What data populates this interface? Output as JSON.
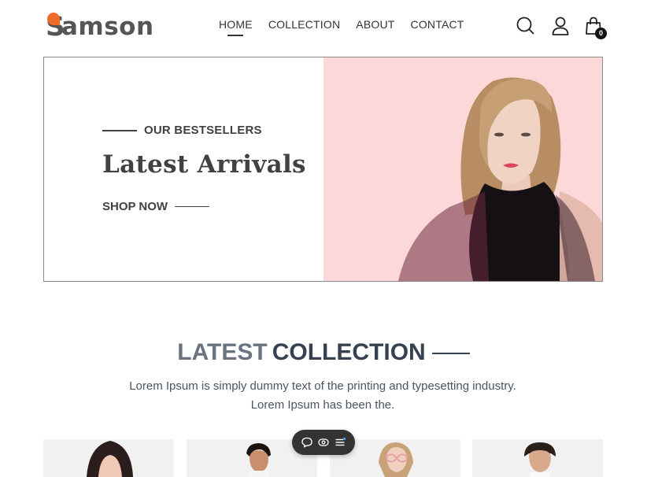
{
  "brand": {
    "logo_letter": "S",
    "logo_rest": "amson",
    "accent_color": "#f06a2a"
  },
  "nav": {
    "items": [
      {
        "label": "HOME",
        "active": true
      },
      {
        "label": "COLLECTION",
        "active": false
      },
      {
        "label": "ABOUT",
        "active": false
      },
      {
        "label": "CONTACT",
        "active": false
      }
    ]
  },
  "header_icons": [
    "search-icon",
    "user-icon",
    "cart-icon"
  ],
  "cart": {
    "count": "0"
  },
  "hero": {
    "eyebrow": "OUR BESTSELLERS",
    "title": "Latest Arrivals",
    "cta": "SHOP NOW",
    "bg_color": "#fcd9d8"
  },
  "collection": {
    "title_light": "LATEST",
    "title_bold": "COLLECTION",
    "description_line1": "Lorem Ipsum is simply dummy text of the printing and typesetting industry.",
    "description_line2": "Lorem Ipsum has been the."
  },
  "products": [
    {
      "image": "product-woman-image"
    },
    {
      "image": "product-man-image"
    },
    {
      "image": "product-kid-sunglasses-image"
    },
    {
      "image": "product-boy-image"
    }
  ],
  "toolbar": {
    "icons": [
      "comment-icon",
      "eye-icon",
      "menu-icon"
    ]
  }
}
